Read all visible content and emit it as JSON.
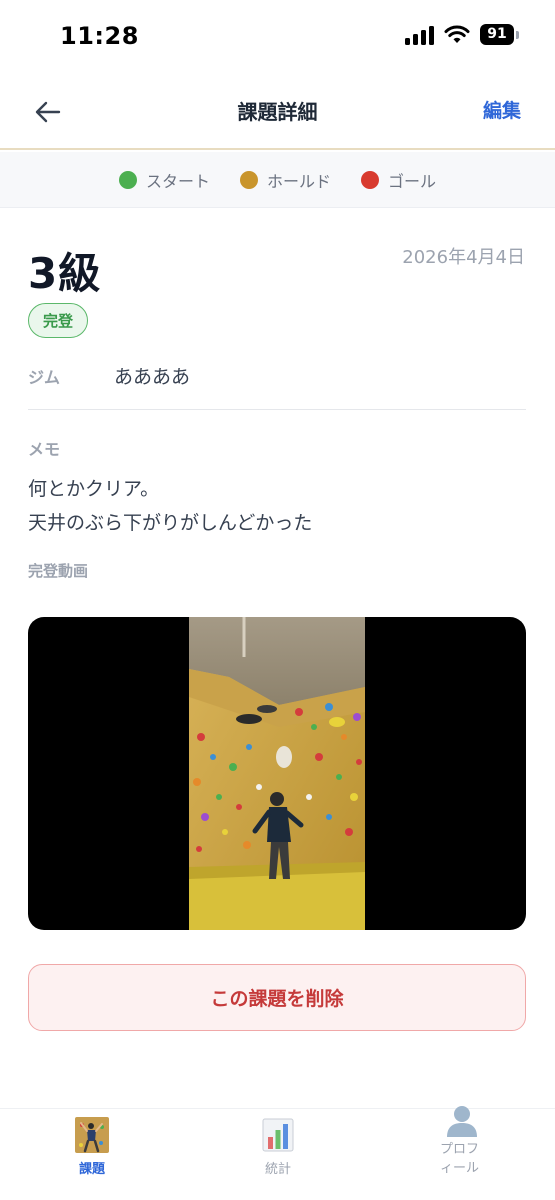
{
  "status_bar": {
    "time": "11:28",
    "battery": "91"
  },
  "header": {
    "title": "課題詳細",
    "edit_label": "編集"
  },
  "legend": [
    {
      "label": "スタート",
      "color": "#4caf50"
    },
    {
      "label": "ホールド",
      "color": "#c9952c"
    },
    {
      "label": "ゴール",
      "color": "#d83a2e"
    }
  ],
  "problem": {
    "grade": "3級",
    "date": "2026年4月4日",
    "status": "完登",
    "gym_label": "ジム",
    "gym_value": "ああああ",
    "memo_label": "メモ",
    "memo_lines": [
      "何とかクリア。",
      "天井のぶら下がりがしんどかった"
    ],
    "video_label": "完登動画"
  },
  "actions": {
    "delete_label": "この課題を削除"
  },
  "tabs": [
    {
      "label": "課題",
      "icon": "climber-icon",
      "active": true
    },
    {
      "label": "統計",
      "icon": "bar-chart-icon",
      "active": false
    },
    {
      "label": "プロフィール",
      "icon": "user-icon",
      "active": false
    }
  ],
  "colors": {
    "accent": "#2f67d8",
    "danger": "#c53a3a",
    "success": "#3a9a4b"
  }
}
